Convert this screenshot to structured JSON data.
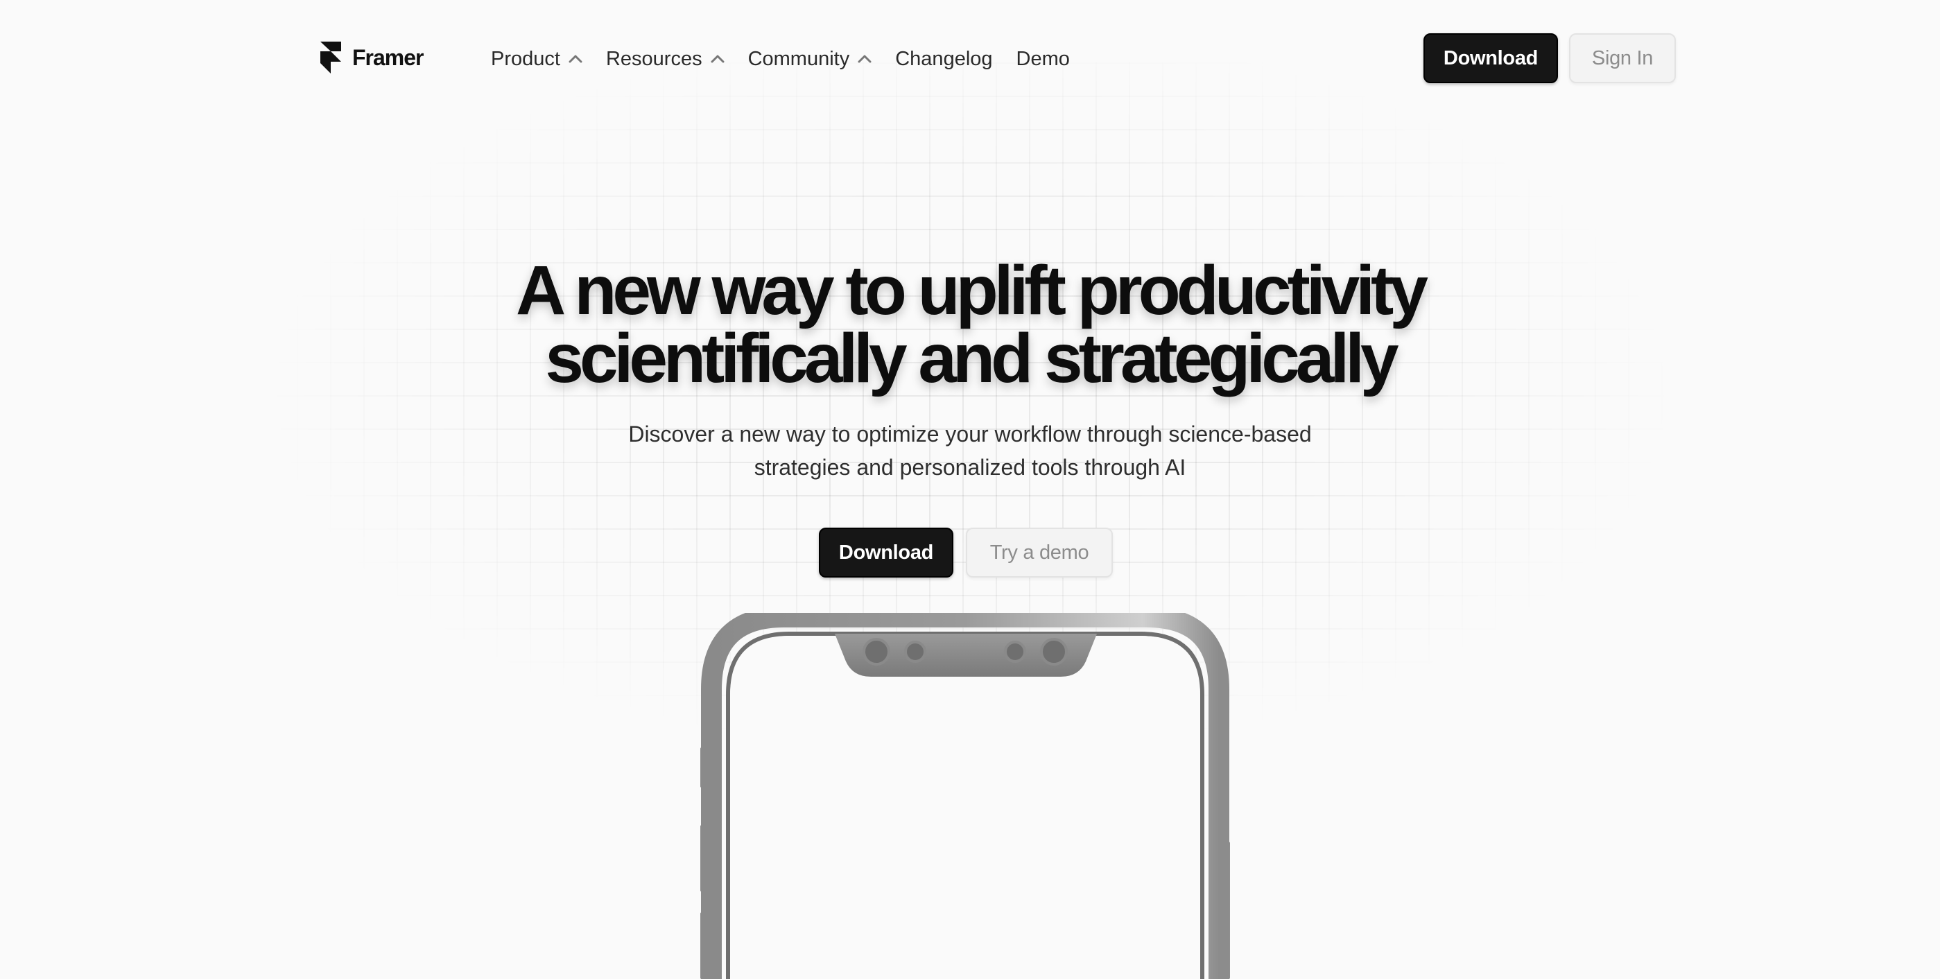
{
  "brand": {
    "name": "Framer",
    "logo_icon": "framer-logo-icon"
  },
  "nav": {
    "items": [
      {
        "label": "Product",
        "icon": "chevron-up-icon"
      },
      {
        "label": "Resources",
        "icon": "chevron-up-icon"
      },
      {
        "label": "Community",
        "icon": "chevron-up-icon"
      },
      {
        "label": "Changelog"
      },
      {
        "label": "Demo"
      }
    ],
    "download_label": "Download",
    "signin_label": "Sign In"
  },
  "hero": {
    "title_line1": "A new way to uplift productivity",
    "title_line2": "scientifically and strategically",
    "subtitle_line1": "Discover a new way to optimize your workflow through science-based",
    "subtitle_line2": "strategies and personalized tools through AI",
    "primary_label": "Download",
    "secondary_label": "Try a demo"
  },
  "colors": {
    "background": "#fafafa",
    "primary_button": "#161616",
    "secondary_button": "#f3f3f3",
    "text": "#111111"
  }
}
